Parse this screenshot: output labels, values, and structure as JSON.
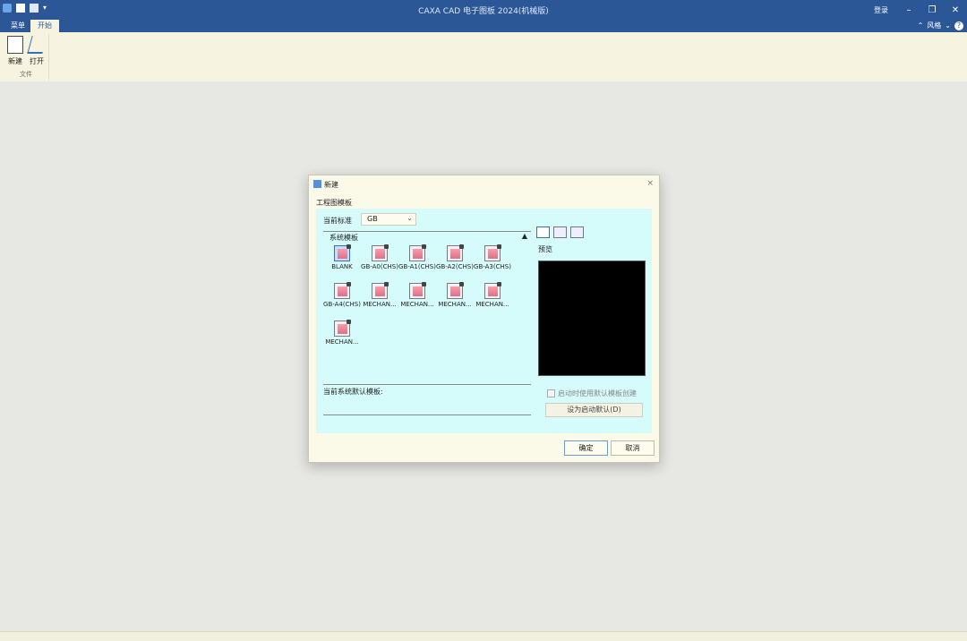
{
  "window": {
    "title": "CAXA CAD 电子图板 2024(机械版)",
    "login": "登录",
    "controls": [
      "–",
      "❐",
      "✕"
    ]
  },
  "tabs": [
    {
      "label": "菜单",
      "active": false
    },
    {
      "label": "开始",
      "active": true
    }
  ],
  "tabbar_right": {
    "style": "风格",
    "help": "?"
  },
  "ribbon": {
    "group_label": "文件",
    "buttons": [
      {
        "label": "新建",
        "icon": "new-file-icon"
      },
      {
        "label": "打开",
        "icon": "open-folder-icon"
      }
    ]
  },
  "dialog": {
    "title": "新建",
    "close": "×",
    "section_title": "工程图模板",
    "standard_label": "当前标准",
    "standard_value": "GB",
    "list_header": "系统模板",
    "collapse_glyph": "▲",
    "templates": [
      "BLANK",
      "GB-A0(CHS)",
      "GB-A1(CHS)",
      "GB-A2(CHS)",
      "GB-A3(CHS)",
      "GB-A4(CHS)",
      "MECHAN...",
      "MECHAN...",
      "MECHAN...",
      "MECHAN...",
      "MECHAN..."
    ],
    "description_label": "当前系统默认模板:",
    "preview_label": "预览",
    "startup_checkbox": "启动时使用默认模板创建",
    "set_default_button": "设为启动默认(D)",
    "ok_button": "确定",
    "cancel_button": "取消"
  }
}
